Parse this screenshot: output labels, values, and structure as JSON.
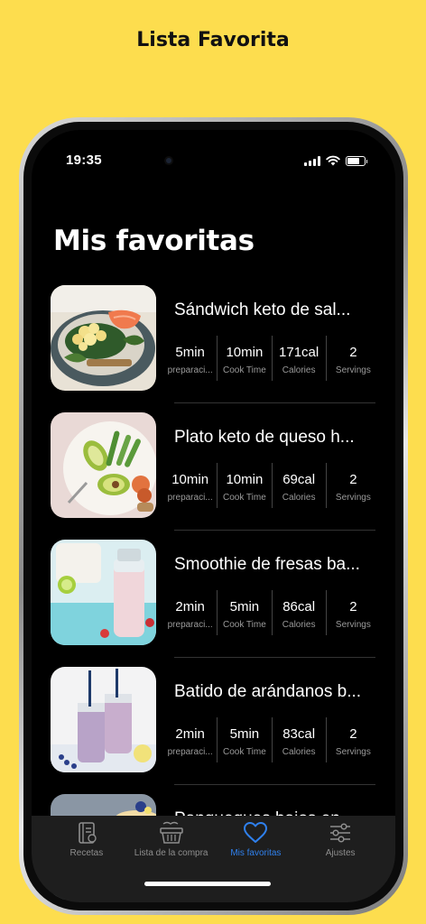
{
  "banner": {
    "title": "Lista Favorita"
  },
  "status_bar": {
    "time": "19:35",
    "battery_level": 0.7
  },
  "page": {
    "title": "Mis favoritas"
  },
  "recipes": [
    {
      "title": "Sándwich keto de sal...",
      "image": "salmon-egg-sandwich",
      "stats": [
        {
          "value": "5min",
          "label": "preparaci..."
        },
        {
          "value": "10min",
          "label": "Cook Time"
        },
        {
          "value": "171cal",
          "label": "Calories"
        },
        {
          "value": "2",
          "label": "Servings"
        }
      ]
    },
    {
      "title": "Plato keto de queso h...",
      "image": "cheese-avocado-plate",
      "stats": [
        {
          "value": "10min",
          "label": "preparaci..."
        },
        {
          "value": "10min",
          "label": "Cook Time"
        },
        {
          "value": "69cal",
          "label": "Calories"
        },
        {
          "value": "2",
          "label": "Servings"
        }
      ]
    },
    {
      "title": "Smoothie de fresas ba...",
      "image": "strawberry-smoothie",
      "stats": [
        {
          "value": "2min",
          "label": "preparaci..."
        },
        {
          "value": "5min",
          "label": "Cook Time"
        },
        {
          "value": "86cal",
          "label": "Calories"
        },
        {
          "value": "2",
          "label": "Servings"
        }
      ]
    },
    {
      "title": "Batido de arándanos b...",
      "image": "blueberry-shake",
      "stats": [
        {
          "value": "2min",
          "label": "preparaci..."
        },
        {
          "value": "5min",
          "label": "Cook Time"
        },
        {
          "value": "83cal",
          "label": "Calories"
        },
        {
          "value": "2",
          "label": "Servings"
        }
      ]
    },
    {
      "title": "Panqueques bajos en...",
      "image": "pancakes"
    }
  ],
  "tabbar": {
    "tabs": [
      {
        "label": "Recetas",
        "icon": "recipe-book-icon",
        "active": false
      },
      {
        "label": "Lista de la compra",
        "icon": "grocery-basket-icon",
        "active": false
      },
      {
        "label": "Mis favoritas",
        "icon": "heart-icon",
        "active": true
      },
      {
        "label": "Ajustes",
        "icon": "sliders-icon",
        "active": false
      }
    ],
    "active_color": "#2F80ED"
  },
  "colors": {
    "background": "#FDDD4E",
    "screen": "#000000",
    "tabbar": "#1E1E1E"
  }
}
